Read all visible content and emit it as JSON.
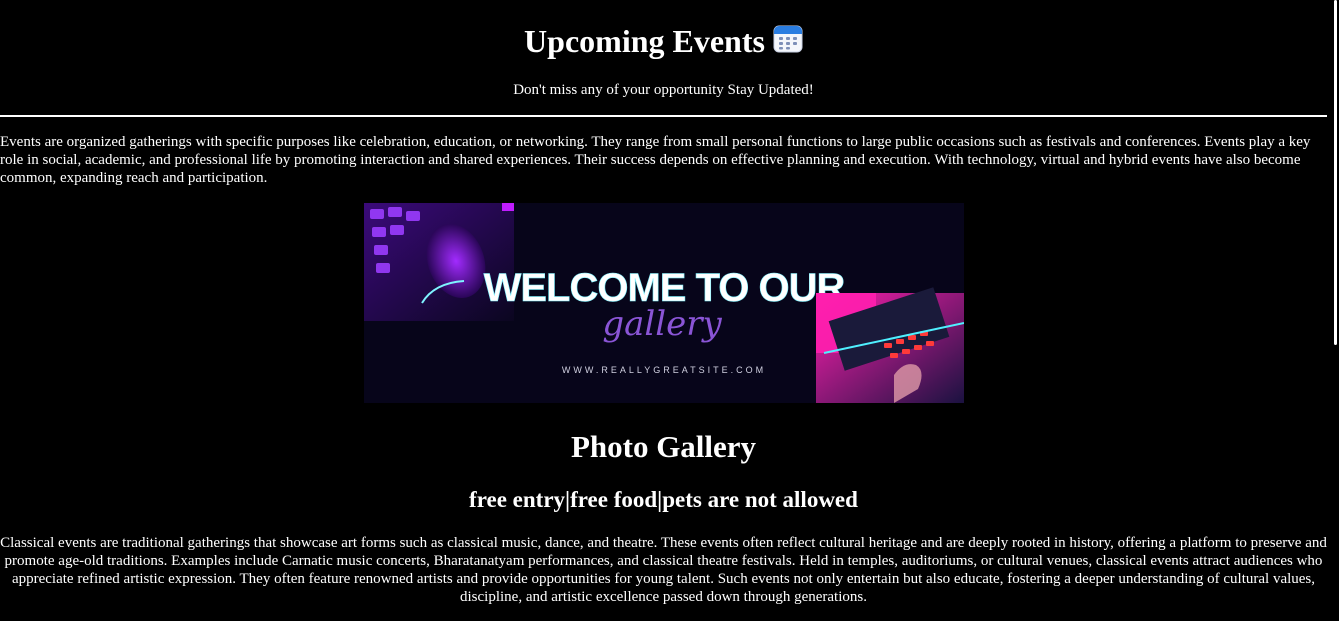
{
  "header": {
    "title": "Upcoming Events",
    "icon": "calendar-icon",
    "subtitle": "Don't miss any of your opportunity Stay Updated!"
  },
  "intro": {
    "text": "Events are organized gatherings with specific purposes like celebration, education, or networking. They range from small personal functions to large public occasions such as festivals and conferences. Events play a key role in social, academic, and professional life by promoting interaction and shared experiences. Their success depends on effective planning and execution. With technology, virtual and hybrid events have also become common, expanding reach and participation."
  },
  "banner": {
    "headline": "WELCOME TO OUR",
    "script": "gallery",
    "url": "WWW.REALLYGREATSITE.COM"
  },
  "gallery": {
    "heading": "Photo Gallery",
    "features": "free entry|free food|pets are not allowed",
    "description": "Classical events are traditional gatherings that showcase art forms such as classical music, dance, and theatre. These events often reflect cultural heritage and are deeply rooted in history, offering a platform to preserve and promote age-old traditions. Examples include Carnatic music concerts, Bharatanatyam performances, and classical theatre festivals. Held in temples, auditoriums, or cultural venues, classical events attract audiences who appreciate refined artistic expression. They often feature renowned artists and provide opportunities for young talent. Such events not only entertain but also educate, fostering a deeper understanding of cultural values, discipline, and artistic excellence passed down through generations."
  },
  "colors": {
    "background": "#000000",
    "text": "#ffffff",
    "neon_purple": "#8b2cff",
    "neon_pink": "#ff2bd6",
    "banner_bg": "#07051a"
  }
}
